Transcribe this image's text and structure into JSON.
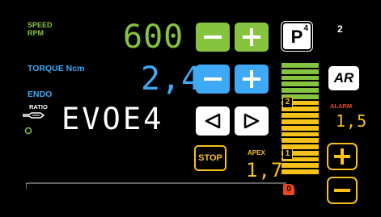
{
  "colors": {
    "green": "#86c440",
    "blue": "#3fa9f5",
    "yellow": "#f6c21a",
    "white": "#ffffff",
    "red": "#e8481e",
    "background": "#000000"
  },
  "speed": {
    "label_top": "SPEED",
    "label_bottom": "RPM",
    "value": "600",
    "minus_icon": "minus-icon",
    "plus_icon": "plus-icon"
  },
  "torque": {
    "label": "TORQUE Ncm",
    "value": "2,4",
    "minus_icon": "minus-icon",
    "plus_icon": "plus-icon"
  },
  "mode": {
    "label": "ENDO",
    "ratio_label": "RATIO",
    "display": "EVOE4",
    "prev_icon": "triangle-left-icon",
    "next_icon": "triangle-right-icon"
  },
  "program": {
    "letter": "P",
    "superscript": "4",
    "number": "2"
  },
  "auto_reverse": {
    "label": "AR"
  },
  "alarm": {
    "label": "ALARM",
    "value": "1,5",
    "plus_icon": "plus-icon",
    "minus_icon": "minus-icon"
  },
  "stop_button": {
    "label": "STOP"
  },
  "apex": {
    "label": "APEX",
    "value": "1,7",
    "zero_marker": "0"
  },
  "apex_scale": {
    "green_bars": 6,
    "yellow_bars": 12,
    "marker_2": "2",
    "marker_1": "1"
  }
}
